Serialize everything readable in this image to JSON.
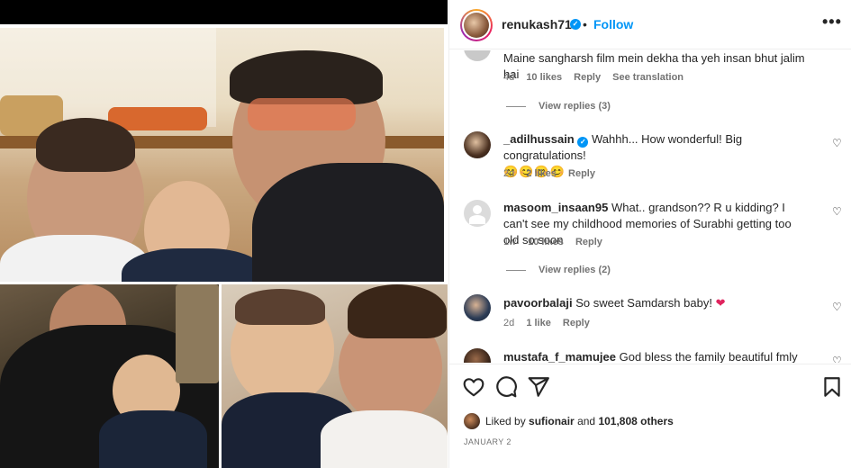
{
  "post": {
    "username": "renukash710",
    "follow_label": "Follow",
    "dot": "•",
    "more_label": "•••"
  },
  "comments": [
    {
      "username": "",
      "text": "Maine sangharsh film mein dekha tha yeh insan bhut jalim hai",
      "time": "4d",
      "likes": "10 likes",
      "reply": "Reply",
      "see_translation": "See translation",
      "view_replies": "View replies (3)"
    },
    {
      "username": "_adilhussain",
      "verified": true,
      "text": "Wahhh... How wonderful! Big congratulations!",
      "emojis": "😊😊😊😊",
      "time": "2d",
      "likes": "2 likes",
      "reply": "Reply"
    },
    {
      "username": "masoom_insaan95",
      "text": "What.. grandson?? R u kidding? I can't see my childhood memories of Surabhi getting too old so soon",
      "time": "1w",
      "likes": "10 likes",
      "reply": "Reply",
      "view_replies": "View replies (2)"
    },
    {
      "username": "pavoorbalaji",
      "text": "So sweet Samdarsh baby!",
      "heart": "❤",
      "time": "2d",
      "likes": "1 like",
      "reply": "Reply"
    },
    {
      "username": "mustafa_f_mamujee",
      "text": "God bless the family beautiful fmly"
    }
  ],
  "likes": {
    "prefix": "Liked by",
    "user": "sufionair",
    "middle": "and",
    "count": "101,808 others"
  },
  "date": "JANUARY 2",
  "icons": {
    "verified": "✓",
    "heart": "♡"
  }
}
